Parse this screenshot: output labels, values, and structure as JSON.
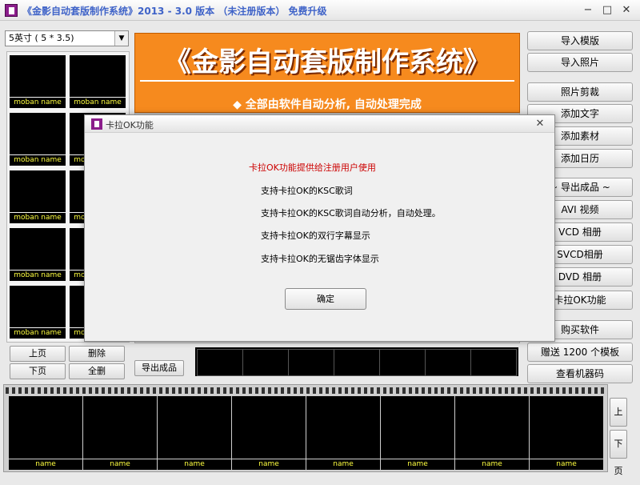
{
  "window": {
    "title": "《金影自动套版制作系统》2013 - 3.0 版本   （未注册版本）   免费升级",
    "min": "−",
    "max": "□",
    "close": "✕"
  },
  "left": {
    "size_select": "5英寸  ( 5 * 3.5)",
    "thumb_label": "moban name",
    "prev": "上页",
    "delete": "删除",
    "next": "下页",
    "delete_all": "全删"
  },
  "banner": {
    "title": "《金影自动套版制作系统》",
    "subtitle": "◆  全部由软件自动分析, 自动处理完成"
  },
  "center": {
    "export_label": "导出成品"
  },
  "right_buttons": [
    "导入模版",
    "导入照片",
    "照片剪裁",
    "添加文字",
    "添加素材",
    "添加日历",
    "~ 导出成品 ~",
    "AVI 视频",
    "VCD 相册",
    "SVCD相册",
    "DVD 相册",
    "卡拉OK功能",
    "购买软件",
    "赠送 1200 个模板",
    "查看机器码"
  ],
  "filmstrip": {
    "cell_label": "name",
    "prev": "上页",
    "next": "下页"
  },
  "dialog": {
    "title": "卡拉OK功能",
    "close": "✕",
    "lines": [
      "卡拉OK功能提供给注册用户使用",
      "支持卡拉OK的KSC歌词",
      " 支持卡拉OK的KSC歌词自动分析，自动处理。",
      "支持卡拉OK的双行字幕显示",
      "支持卡拉OK的无锯齿字体显示"
    ],
    "ok": "确定",
    "accent": "#cc0000"
  }
}
